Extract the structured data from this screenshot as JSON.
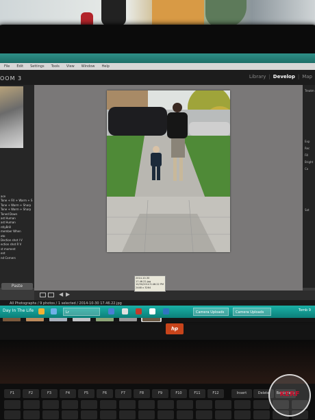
{
  "menubar": {
    "items": [
      "File",
      "Edit",
      "Settings",
      "Tools",
      "View",
      "Window",
      "Help"
    ]
  },
  "app": {
    "brand": "OOM 3",
    "modules": [
      "Library",
      "Develop",
      "Map"
    ],
    "active_module": "Develop"
  },
  "left_panel": {
    "presets": [
      "ace",
      "Tone + Fill + Warm + S",
      "Tone + Warm + Sharp",
      "Tone + Warm + Sharp",
      "Toned Down",
      "ast Human",
      "ast Human",
      "ntlyBrill",
      "member When",
      "",
      "oto",
      "Dection shot I V",
      "ection shot R V",
      "st moment",
      "",
      "ent",
      "nd Corners"
    ],
    "paste_label": "Paste"
  },
  "right_panel": {
    "labels": [
      "Treatm",
      "Exp",
      "Rec",
      "Fill",
      "Bright",
      "Co",
      "Sat"
    ]
  },
  "filmstrip": {
    "info": "All Photographs / 9 photos / 1 selected / 2014-10-30 17.46.22.jpg",
    "tooltip": "2014-10-30 17.46.22.jpg 10/30/2014 5:46:22 PM 2448 x 3264",
    "thumb_colors": [
      "#7b5a3d",
      "#bd8b5d",
      "#a9b2bd",
      "#c2c4c7",
      "#8ea679",
      "#9a9a9a",
      "#6b5a45"
    ]
  },
  "taskbar": {
    "start_label": "Day In The Life",
    "buttons": [
      "Lr",
      "Camera Uploads",
      "Camera Uploads"
    ],
    "tray": "Tomb 9"
  },
  "hp_logo": "hp",
  "keyboard": {
    "keys": [
      "F1",
      "F2",
      "F3",
      "F4",
      "F5",
      "F6",
      "F7",
      "F8",
      "F9",
      "F10",
      "F11",
      "F12",
      "Insert",
      "Delete",
      "Backspace"
    ]
  },
  "watermark": {
    "text": "KERF"
  }
}
